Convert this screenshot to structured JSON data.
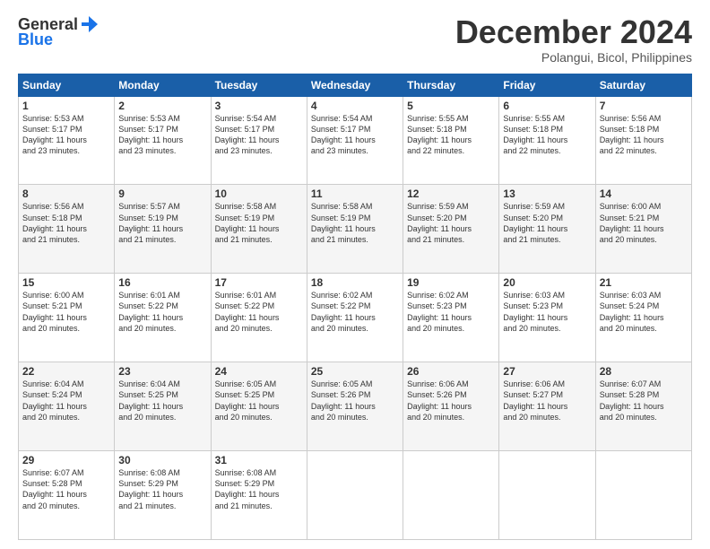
{
  "header": {
    "logo_line1": "General",
    "logo_line2": "Blue",
    "month": "December 2024",
    "location": "Polangui, Bicol, Philippines"
  },
  "weekdays": [
    "Sunday",
    "Monday",
    "Tuesday",
    "Wednesday",
    "Thursday",
    "Friday",
    "Saturday"
  ],
  "weeks": [
    [
      {
        "day": "1",
        "info": "Sunrise: 5:53 AM\nSunset: 5:17 PM\nDaylight: 11 hours\nand 23 minutes."
      },
      {
        "day": "2",
        "info": "Sunrise: 5:53 AM\nSunset: 5:17 PM\nDaylight: 11 hours\nand 23 minutes."
      },
      {
        "day": "3",
        "info": "Sunrise: 5:54 AM\nSunset: 5:17 PM\nDaylight: 11 hours\nand 23 minutes."
      },
      {
        "day": "4",
        "info": "Sunrise: 5:54 AM\nSunset: 5:17 PM\nDaylight: 11 hours\nand 23 minutes."
      },
      {
        "day": "5",
        "info": "Sunrise: 5:55 AM\nSunset: 5:18 PM\nDaylight: 11 hours\nand 22 minutes."
      },
      {
        "day": "6",
        "info": "Sunrise: 5:55 AM\nSunset: 5:18 PM\nDaylight: 11 hours\nand 22 minutes."
      },
      {
        "day": "7",
        "info": "Sunrise: 5:56 AM\nSunset: 5:18 PM\nDaylight: 11 hours\nand 22 minutes."
      }
    ],
    [
      {
        "day": "8",
        "info": "Sunrise: 5:56 AM\nSunset: 5:18 PM\nDaylight: 11 hours\nand 21 minutes."
      },
      {
        "day": "9",
        "info": "Sunrise: 5:57 AM\nSunset: 5:19 PM\nDaylight: 11 hours\nand 21 minutes."
      },
      {
        "day": "10",
        "info": "Sunrise: 5:58 AM\nSunset: 5:19 PM\nDaylight: 11 hours\nand 21 minutes."
      },
      {
        "day": "11",
        "info": "Sunrise: 5:58 AM\nSunset: 5:19 PM\nDaylight: 11 hours\nand 21 minutes."
      },
      {
        "day": "12",
        "info": "Sunrise: 5:59 AM\nSunset: 5:20 PM\nDaylight: 11 hours\nand 21 minutes."
      },
      {
        "day": "13",
        "info": "Sunrise: 5:59 AM\nSunset: 5:20 PM\nDaylight: 11 hours\nand 21 minutes."
      },
      {
        "day": "14",
        "info": "Sunrise: 6:00 AM\nSunset: 5:21 PM\nDaylight: 11 hours\nand 20 minutes."
      }
    ],
    [
      {
        "day": "15",
        "info": "Sunrise: 6:00 AM\nSunset: 5:21 PM\nDaylight: 11 hours\nand 20 minutes."
      },
      {
        "day": "16",
        "info": "Sunrise: 6:01 AM\nSunset: 5:22 PM\nDaylight: 11 hours\nand 20 minutes."
      },
      {
        "day": "17",
        "info": "Sunrise: 6:01 AM\nSunset: 5:22 PM\nDaylight: 11 hours\nand 20 minutes."
      },
      {
        "day": "18",
        "info": "Sunrise: 6:02 AM\nSunset: 5:22 PM\nDaylight: 11 hours\nand 20 minutes."
      },
      {
        "day": "19",
        "info": "Sunrise: 6:02 AM\nSunset: 5:23 PM\nDaylight: 11 hours\nand 20 minutes."
      },
      {
        "day": "20",
        "info": "Sunrise: 6:03 AM\nSunset: 5:23 PM\nDaylight: 11 hours\nand 20 minutes."
      },
      {
        "day": "21",
        "info": "Sunrise: 6:03 AM\nSunset: 5:24 PM\nDaylight: 11 hours\nand 20 minutes."
      }
    ],
    [
      {
        "day": "22",
        "info": "Sunrise: 6:04 AM\nSunset: 5:24 PM\nDaylight: 11 hours\nand 20 minutes."
      },
      {
        "day": "23",
        "info": "Sunrise: 6:04 AM\nSunset: 5:25 PM\nDaylight: 11 hours\nand 20 minutes."
      },
      {
        "day": "24",
        "info": "Sunrise: 6:05 AM\nSunset: 5:25 PM\nDaylight: 11 hours\nand 20 minutes."
      },
      {
        "day": "25",
        "info": "Sunrise: 6:05 AM\nSunset: 5:26 PM\nDaylight: 11 hours\nand 20 minutes."
      },
      {
        "day": "26",
        "info": "Sunrise: 6:06 AM\nSunset: 5:26 PM\nDaylight: 11 hours\nand 20 minutes."
      },
      {
        "day": "27",
        "info": "Sunrise: 6:06 AM\nSunset: 5:27 PM\nDaylight: 11 hours\nand 20 minutes."
      },
      {
        "day": "28",
        "info": "Sunrise: 6:07 AM\nSunset: 5:28 PM\nDaylight: 11 hours\nand 20 minutes."
      }
    ],
    [
      {
        "day": "29",
        "info": "Sunrise: 6:07 AM\nSunset: 5:28 PM\nDaylight: 11 hours\nand 20 minutes."
      },
      {
        "day": "30",
        "info": "Sunrise: 6:08 AM\nSunset: 5:29 PM\nDaylight: 11 hours\nand 21 minutes."
      },
      {
        "day": "31",
        "info": "Sunrise: 6:08 AM\nSunset: 5:29 PM\nDaylight: 11 hours\nand 21 minutes."
      },
      null,
      null,
      null,
      null
    ]
  ]
}
